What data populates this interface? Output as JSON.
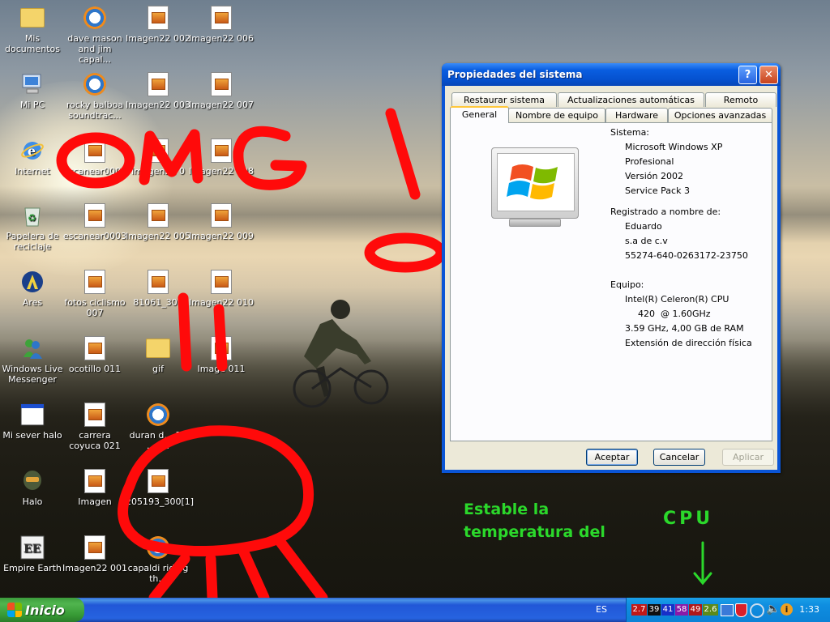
{
  "desktop": {
    "icons": [
      {
        "label": "Mis documentos",
        "icon": "folder-icon"
      },
      {
        "label": "Mi PC",
        "icon": "computer-icon"
      },
      {
        "label": "Internet",
        "icon": "internet-explorer-icon"
      },
      {
        "label": "Papelera de reciclaje",
        "icon": "recycle-bin-icon"
      },
      {
        "label": "Ares",
        "icon": "ares-icon"
      },
      {
        "label": "Windows Live Messenger",
        "icon": "messenger-icon"
      },
      {
        "label": "Mi sever halo",
        "icon": "app-window-icon"
      },
      {
        "label": "Halo",
        "icon": "halo-icon"
      },
      {
        "label": "Empire Earth",
        "icon": "empire-earth-icon"
      },
      {
        "label": "dave mason and jim capal...",
        "icon": "media-file-icon"
      },
      {
        "label": "rocky balboa soundtrac...",
        "icon": "media-file-icon"
      },
      {
        "label": "escanear0002",
        "icon": "image-file-icon"
      },
      {
        "label": "escanear0003",
        "icon": "image-file-icon"
      },
      {
        "label": "fotos ciclismo 007",
        "icon": "image-file-icon"
      },
      {
        "label": "ocotillo 011",
        "icon": "image-file-icon"
      },
      {
        "label": "carrera coyuca 021",
        "icon": "image-file-icon"
      },
      {
        "label": "Imagen",
        "icon": "image-file-icon"
      },
      {
        "label": "Imagen22 001",
        "icon": "image-file-icon"
      },
      {
        "label": "Imagen22 002",
        "icon": "image-file-icon"
      },
      {
        "label": "Imagen22 003",
        "icon": "image-file-icon"
      },
      {
        "label": "Imagen22 0",
        "icon": "image-file-icon"
      },
      {
        "label": "Imagen22 005",
        "icon": "image-file-icon"
      },
      {
        "label": "81061_300",
        "icon": "image-file-icon"
      },
      {
        "label": "gif",
        "icon": "folder-icon"
      },
      {
        "label": "duran d... 10 ... r...",
        "icon": "media-file-icon"
      },
      {
        "label": "205193_300[1]",
        "icon": "image-file-icon"
      },
      {
        "label": "capaldi riding th...",
        "icon": "media-file-icon"
      },
      {
        "label": "Imagen22 006",
        "icon": "image-file-icon"
      },
      {
        "label": "Imagen22 007",
        "icon": "image-file-icon"
      },
      {
        "label": "Imagen22 008",
        "icon": "image-file-icon"
      },
      {
        "label": "Imagen22 009",
        "icon": "image-file-icon"
      },
      {
        "label": "Imagen22 010",
        "icon": "image-file-icon"
      },
      {
        "label": "Image 011",
        "icon": "image-file-icon"
      }
    ]
  },
  "annotations": {
    "drawn": "OMG!",
    "note_line1": "Estable la",
    "note_line2": "temperatura del",
    "note_cpu": "CPU"
  },
  "dialog": {
    "title": "Propiedades del sistema",
    "tabs_top": [
      "Restaurar sistema",
      "Actualizaciones automáticas",
      "Remoto"
    ],
    "tabs_bottom": [
      "General",
      "Nombre de equipo",
      "Hardware",
      "Opciones avanzadas"
    ],
    "active_tab": "General",
    "system_label": "Sistema:",
    "system": [
      "Microsoft Windows XP",
      "Profesional",
      "Versión 2002",
      "Service Pack 3"
    ],
    "registered_label": "Registrado a nombre de:",
    "registered": [
      "Eduardo",
      "s.a de c.v",
      "55274-640-0263172-23750"
    ],
    "equipment_label": "Equipo:",
    "equipment": [
      "Intel(R) Celeron(R) CPU",
      "420  @ 1.60GHz",
      "3.59 GHz, 4,00 GB de RAM",
      "Extensión de dirección física"
    ],
    "buttons": {
      "ok": "Aceptar",
      "cancel": "Cancelar",
      "apply": "Aplicar"
    }
  },
  "taskbar": {
    "start_label": "Inicio",
    "language": "ES",
    "tray_readings": [
      {
        "value": "2.7",
        "color": "#c01818"
      },
      {
        "value": "39",
        "color": "#101010"
      },
      {
        "value": "41",
        "color": "#1830c8"
      },
      {
        "value": "58",
        "color": "#8a1aa8"
      },
      {
        "value": "49",
        "color": "#b0181a"
      },
      {
        "value": "2.6",
        "color": "#5c8a1a"
      }
    ],
    "clock": "1:33"
  }
}
